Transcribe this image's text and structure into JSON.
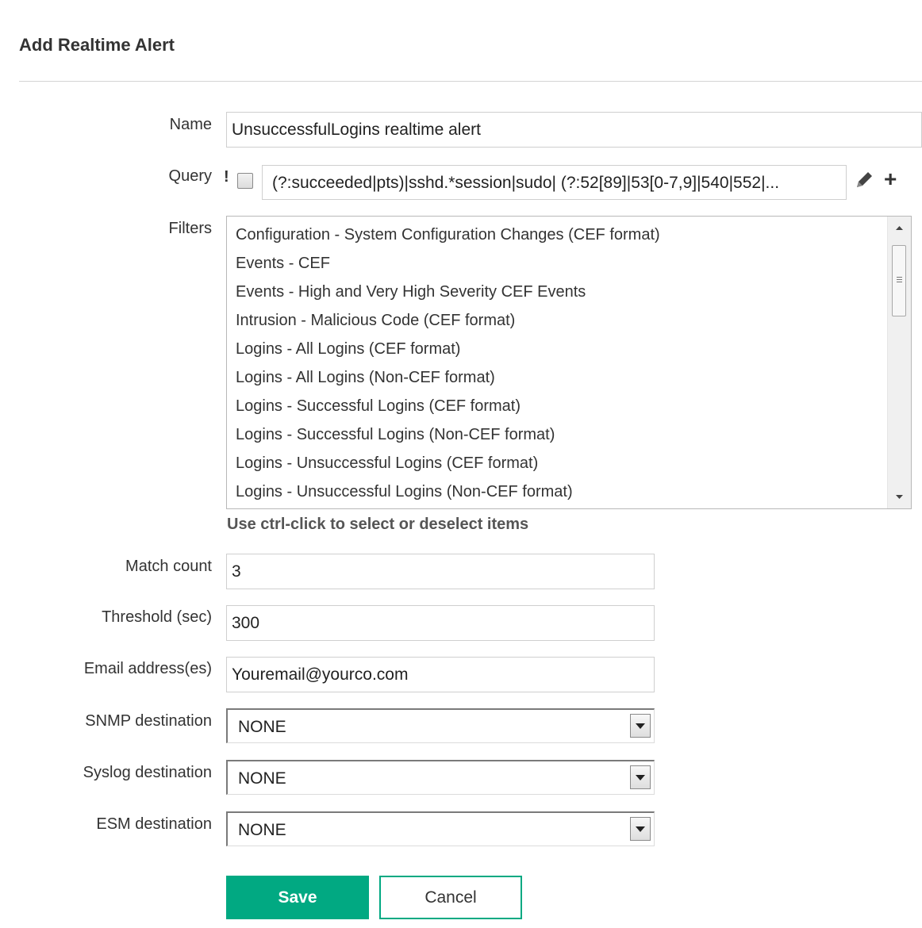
{
  "page": {
    "title": "Add Realtime Alert"
  },
  "form": {
    "name": {
      "label": "Name",
      "value": "UnsuccessfulLogins realtime alert"
    },
    "query": {
      "label": "Query",
      "negate_symbol": "!",
      "negate_checked": false,
      "value": "(?:succeeded|pts)|sshd.*session|sudo| (?:52[89]|53[0-7,9]|540|552|..."
    },
    "filters": {
      "label": "Filters",
      "items": [
        "Configuration - System Configuration Changes (CEF format)",
        "Events - CEF",
        "Events - High and Very High Severity CEF Events",
        "Intrusion - Malicious Code (CEF format)",
        "Logins - All Logins (CEF format)",
        "Logins - All Logins (Non-CEF format)",
        "Logins - Successful Logins (CEF format)",
        "Logins - Successful Logins (Non-CEF format)",
        "Logins - Unsuccessful Logins (CEF format)",
        "Logins - Unsuccessful Logins (Non-CEF format)"
      ],
      "hint": "Use ctrl-click to select or deselect items"
    },
    "match_count": {
      "label": "Match count",
      "value": "3"
    },
    "threshold": {
      "label": "Threshold (sec)",
      "value": "300"
    },
    "email": {
      "label": "Email address(es)",
      "value": "Youremail@yourco.com"
    },
    "snmp": {
      "label": "SNMP destination",
      "value": "NONE"
    },
    "syslog": {
      "label": "Syslog destination",
      "value": "NONE"
    },
    "esm": {
      "label": "ESM destination",
      "value": "NONE"
    }
  },
  "buttons": {
    "save": "Save",
    "cancel": "Cancel"
  },
  "icons": {
    "edit": "pencil-icon",
    "add": "plus-icon"
  },
  "colors": {
    "accent": "#01a982"
  }
}
